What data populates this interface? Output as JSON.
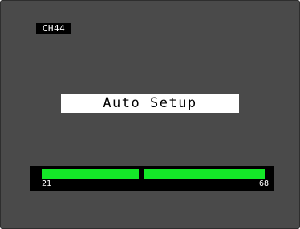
{
  "osd": {
    "channel": "CH44",
    "title": "Auto Setup",
    "scan": {
      "range_min": "21",
      "range_max": "68",
      "bar_color": "#14e828",
      "background_color": "#4a4a4a"
    }
  }
}
